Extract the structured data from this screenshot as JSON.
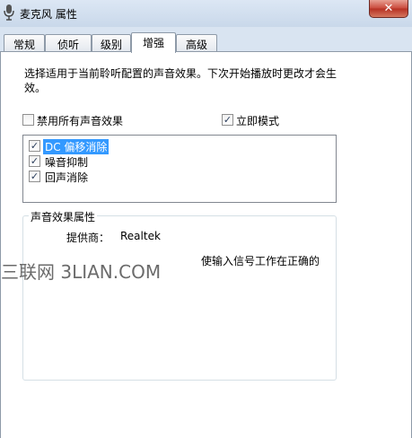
{
  "window": {
    "title": "麦克风 属性",
    "close_glyph": "✕"
  },
  "tabs": [
    {
      "label": "常规",
      "active": false
    },
    {
      "label": "侦听",
      "active": false
    },
    {
      "label": "级别",
      "active": false
    },
    {
      "label": "增强",
      "active": true
    },
    {
      "label": "高级",
      "active": false
    }
  ],
  "enhancements": {
    "description": "选择适用于当前聆听配置的声音效果。下次开始播放时更改才会生效。",
    "disable_all_label": "禁用所有声音效果",
    "disable_all_checked": false,
    "immediate_mode_label": "立即模式",
    "immediate_mode_checked": true,
    "effects": [
      {
        "label": "DC 偏移消除",
        "checked": true,
        "selected": true
      },
      {
        "label": "噪音抑制",
        "checked": true,
        "selected": false
      },
      {
        "label": "回声消除",
        "checked": true,
        "selected": false
      }
    ],
    "properties": {
      "legend": "声音效果属性",
      "provider_label": "提供商：",
      "provider_value": "Realtek",
      "description_fragment": "使输入信号工作在正确的"
    }
  },
  "watermark": {
    "text": "三联网 3LIAN.COM"
  },
  "icons": {
    "app": "microphone-icon",
    "check": "checkmark-icon",
    "close": "close-icon"
  },
  "colors": {
    "selection": "#3399ff",
    "close_button": "#c9483a",
    "title_bar": "#d9e4f1"
  }
}
